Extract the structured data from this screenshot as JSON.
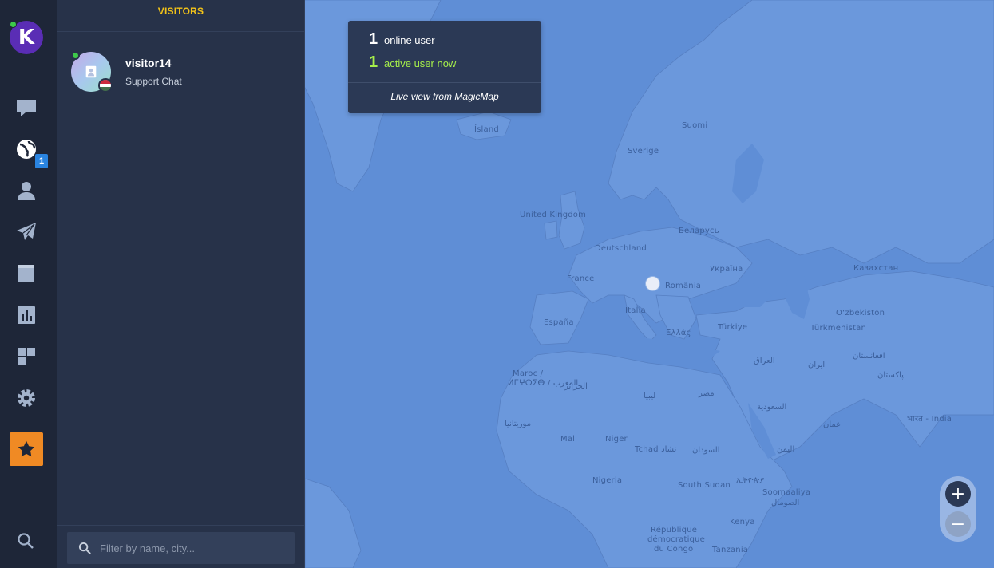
{
  "rail": {
    "logo_letter": "K",
    "icons": [
      "chat-icon",
      "globe-icon",
      "user-icon",
      "send-icon",
      "book-icon",
      "chart-icon",
      "apps-icon",
      "gear-icon",
      "star-icon",
      "search-icon"
    ],
    "badge": "1",
    "accent": "#f08a24"
  },
  "panel": {
    "title": "VISITORS",
    "visitor": {
      "name": "visitor14",
      "subtitle": "Support Chat",
      "status_color": "#3ec94a",
      "flag_colors": [
        "#cd2a3e",
        "#ffffff",
        "#436f4d"
      ]
    },
    "filter_placeholder": "Filter by name, city..."
  },
  "map": {
    "info": {
      "online_count": "1",
      "online_label": "online user",
      "active_count": "1",
      "active_label": "active user now",
      "footer": "Live view from MagicMap"
    },
    "labels": {
      "island": "Ísland",
      "suomi": "Suomi",
      "sverige": "Sverige",
      "uk": "United Kingdom",
      "belarus": "Беларусь",
      "deutschland": "Deutschland",
      "ukraina": "Україна",
      "kazakhstan": "Казахстан",
      "france": "France",
      "romania": "România",
      "italia": "Italia",
      "espana": "España",
      "ellas": "Ελλάς",
      "turkiye": "Türkiye",
      "uzbekistan": "O‘zbekiston",
      "turkmenistan": "Türkmenistan",
      "iraq": "العراق",
      "iran": "ایران",
      "afghanistan": "افغانستان",
      "maroc": "Maroc /",
      "maroc2": "ⵍⵎⵖⵔⵉⴱ / المغرب",
      "algeria": "الجزائر",
      "libya": "ليبيا",
      "egypt": "مصر",
      "pakistan": "پاکستان",
      "saudi": "السعودية",
      "oman": "عمان",
      "india": "भारत - India",
      "mauritania": "موريتانيا",
      "mali": "Mali",
      "niger": "Niger",
      "tchad": "Tchad تشاد",
      "sudan": "السودان",
      "yemen": "اليمن",
      "nigeria": "Nigeria",
      "south_sudan": "South Sudan",
      "ethiopia": "ኢትዮጵያ",
      "somalia": "Soomaaliya",
      "somalia2": "الصومال",
      "kenya": "Kenya",
      "drc1": "République",
      "drc2": "démocratique",
      "drc3": "du Congo",
      "tanzania": "Tanzania"
    },
    "zoom_in": "+",
    "zoom_out": "−",
    "highlight_color": "#a6ef4a"
  }
}
